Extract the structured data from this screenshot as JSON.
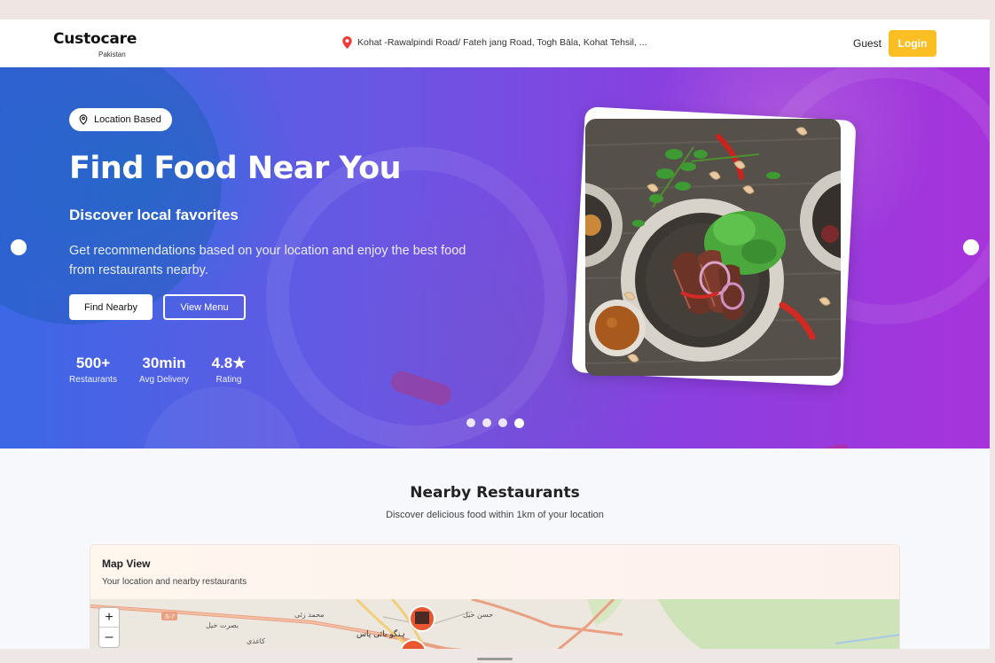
{
  "navbar": {
    "brand": "Custocare",
    "brand_sub": "Pakistan",
    "location": "Kohat -Rawalpindi Road/ Fateh jang Road, Togh Bāla, Kohat Tehsil, ...",
    "guest_label": "Guest",
    "login_label": "Login"
  },
  "hero": {
    "badge": "Location Based",
    "title": "Find Food Near You",
    "subtitle": "Discover local favorites",
    "description": "Get recommendations based on your location and enjoy the best food from restaurants nearby.",
    "find_nearby_label": "Find Nearby",
    "view_menu_label": "View Menu",
    "stats": [
      {
        "value": "500+",
        "label": "Restaurants"
      },
      {
        "value": "30min",
        "label": "Avg Delivery"
      },
      {
        "value": "4.8★",
        "label": "Rating"
      }
    ],
    "slide_count": 4,
    "active_slide": 4
  },
  "nearby": {
    "title": "Nearby Restaurants",
    "subtitle": "Discover delicious food within 1km of your location"
  },
  "map": {
    "title": "Map View",
    "subtitle": "Your location and nearby restaurants",
    "zoom_in_label": "+",
    "zoom_out_label": "–",
    "road_label": "S-7",
    "place_labels": [
      "محمد زئی",
      "بصرت خیل",
      "کاغذی",
      "ہنگو بائی پاس",
      "حسن خیل"
    ]
  },
  "colors": {
    "accent": "#fbbf24",
    "hero_gradient_start": "#3b68e6",
    "hero_gradient_end": "#a734db",
    "pin": "#ef3b3b"
  },
  "icons": {
    "location_pin": "map-pin-icon",
    "badge_pin": "map-pin-outline-icon",
    "arrow_left": "carousel-prev-icon",
    "arrow_right": "carousel-next-icon"
  }
}
